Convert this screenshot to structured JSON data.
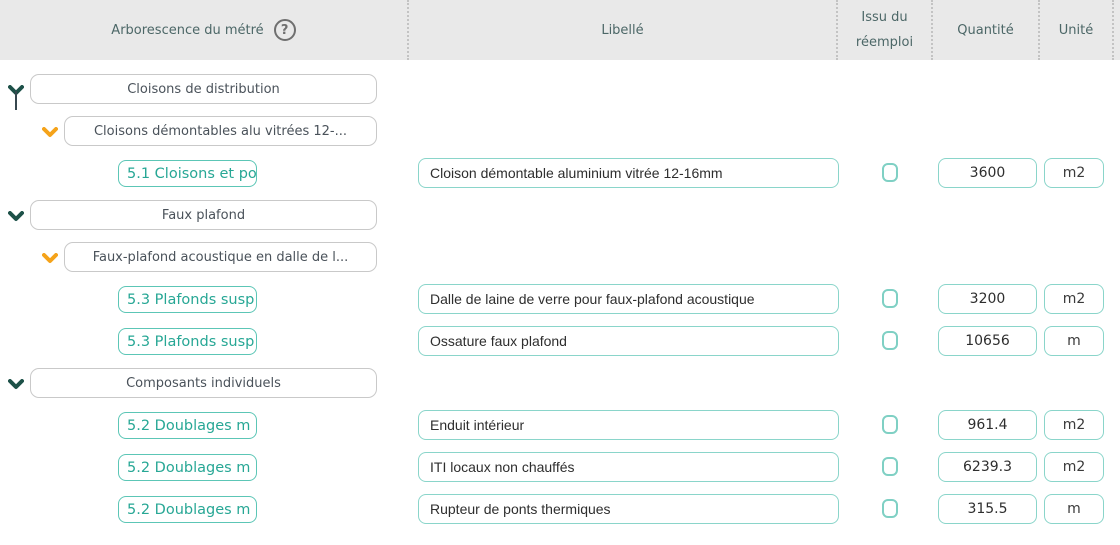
{
  "header": {
    "tree_label": "Arborescence du métré",
    "help_icon": "?",
    "libelle_label": "Libellé",
    "reuse_line1": "Issu du",
    "reuse_line2": "réemploi",
    "quantity_label": "Quantité",
    "unit_label": "Unité"
  },
  "colors": {
    "accent_teal": "#27a795",
    "input_border_teal": "#8ad5ca",
    "chip_border_teal": "#5cc6b6",
    "chevron_dark_green": "#1d5148",
    "chevron_orange": "#f5a31a",
    "header_bg": "#e9e9e9",
    "group_border_gray": "#c9c9c9"
  },
  "rows": [
    {
      "type": "group",
      "level": 0,
      "label": "Cloisons de distribution"
    },
    {
      "type": "group",
      "level": 1,
      "label": "Cloisons démontables alu vitrées 12-..."
    },
    {
      "type": "leaf",
      "lot": "5.1 Cloisons et po",
      "libelle": "Cloison démontable aluminium vitrée 12-16mm",
      "reuse_checked": false,
      "quantity": "3600",
      "unit": "m2"
    },
    {
      "type": "group",
      "level": 0,
      "label": "Faux plafond"
    },
    {
      "type": "group",
      "level": 1,
      "label": "Faux-plafond acoustique en dalle de l..."
    },
    {
      "type": "leaf",
      "lot": "5.3 Plafonds susp",
      "libelle": "Dalle de laine de verre pour faux-plafond acoustique",
      "reuse_checked": false,
      "quantity": "3200",
      "unit": "m2"
    },
    {
      "type": "leaf",
      "lot": "5.3 Plafonds susp",
      "libelle": "Ossature faux plafond",
      "reuse_checked": false,
      "quantity": "10656",
      "unit": "m"
    },
    {
      "type": "group",
      "level": 0,
      "label": "Composants individuels"
    },
    {
      "type": "leaf",
      "lot": "5.2 Doublages m",
      "libelle": "Enduit intérieur",
      "reuse_checked": false,
      "quantity": "961.4",
      "unit": "m2"
    },
    {
      "type": "leaf",
      "lot": "5.2 Doublages m",
      "libelle": "ITI locaux non chauffés",
      "reuse_checked": false,
      "quantity": "6239.3",
      "unit": "m2"
    },
    {
      "type": "leaf",
      "lot": "5.2 Doublages m",
      "libelle": "Rupteur de ponts thermiques",
      "reuse_checked": false,
      "quantity": "315.5",
      "unit": "m"
    }
  ]
}
